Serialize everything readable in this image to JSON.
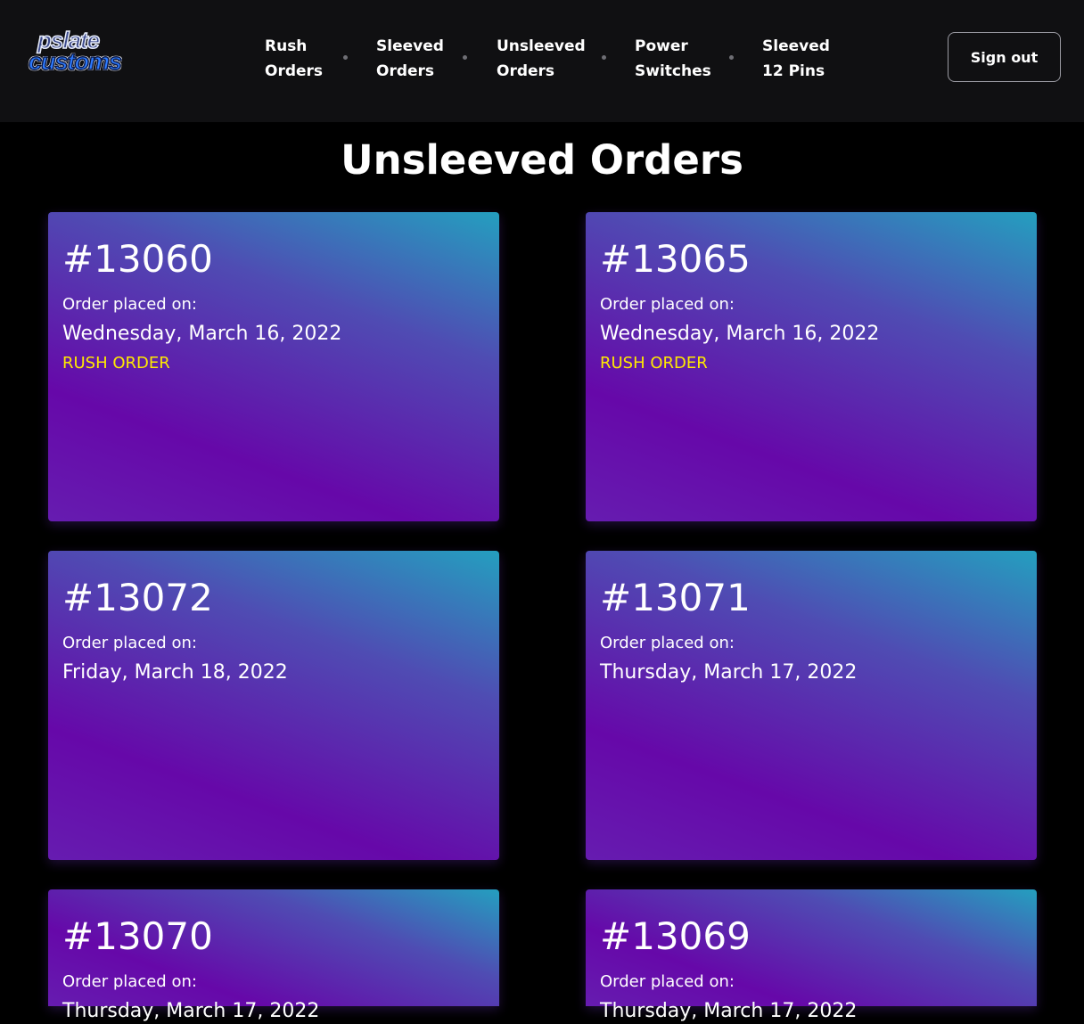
{
  "brand": {
    "logo_line1": "pslate",
    "logo_line2": "customs"
  },
  "nav": {
    "items": [
      {
        "line1": "Rush",
        "line2": "Orders"
      },
      {
        "line1": "Sleeved",
        "line2": "Orders"
      },
      {
        "line1": "Unsleeved",
        "line2": "Orders"
      },
      {
        "line1": "Power",
        "line2": "Switches"
      },
      {
        "line1": "Sleeved",
        "line2": "12 Pins"
      }
    ],
    "signout_label": "Sign out"
  },
  "page": {
    "title": "Unsleeved Orders"
  },
  "orders": [
    {
      "number": "#13060",
      "placed_label": "Order placed on:",
      "date": "Wednesday, March 16, 2022",
      "badge": "RUSH ORDER"
    },
    {
      "number": "#13065",
      "placed_label": "Order placed on:",
      "date": "Wednesday, March 16, 2022",
      "badge": "RUSH ORDER"
    },
    {
      "number": "#13072",
      "placed_label": "Order placed on:",
      "date": "Friday, March 18, 2022",
      "badge": ""
    },
    {
      "number": "#13071",
      "placed_label": "Order placed on:",
      "date": "Thursday, March 17, 2022",
      "badge": ""
    },
    {
      "number": "#13070",
      "placed_label": "Order placed on:",
      "date": "Thursday, March 17, 2022",
      "badge": ""
    },
    {
      "number": "#13069",
      "placed_label": "Order placed on:",
      "date": "Thursday, March 17, 2022",
      "badge": ""
    }
  ],
  "colors": {
    "topbar": "#101012",
    "background": "#000000",
    "rush_badge": "#ffe900",
    "card_gradient_start": "#249fbf",
    "card_gradient_end": "#6608a9"
  }
}
